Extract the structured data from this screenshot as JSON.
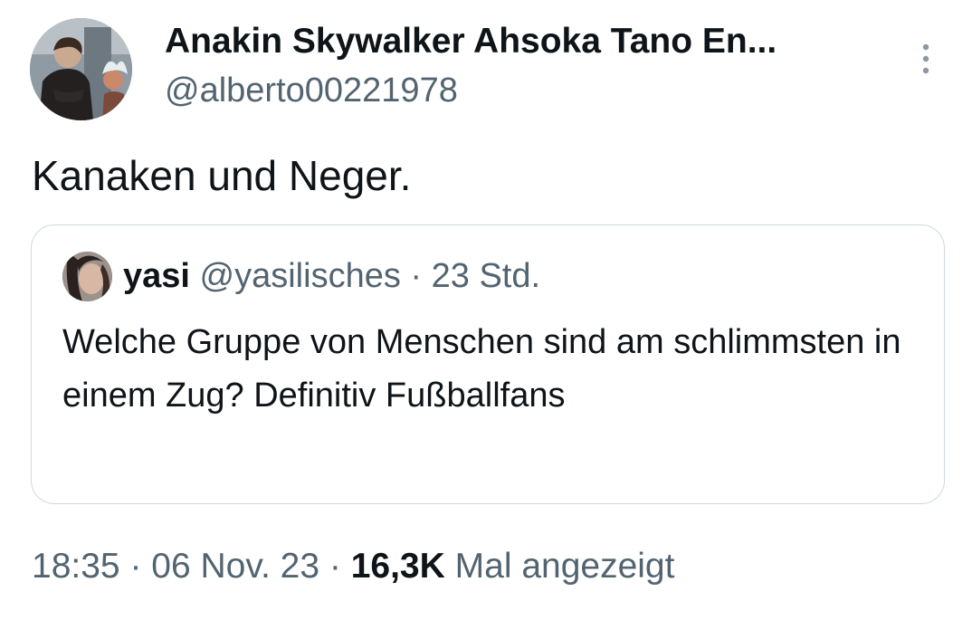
{
  "author": {
    "display_name": "Anakin Skywalker Ahsoka Tano En...",
    "handle": "@alberto00221978",
    "avatar_icon": "profile-photo-avatar"
  },
  "more_icon": "more-vertical-icon",
  "tweet": {
    "text": "Kanaken und Neger."
  },
  "quote": {
    "avatar_icon": "profile-photo-avatar",
    "name": "yasi",
    "handle": "@yasilisches",
    "separator": "·",
    "time": "23 Std.",
    "text": "Welche Gruppe von Menschen sind am schlimmsten in einem Zug? Definitiv Fußballfans"
  },
  "meta": {
    "time": "18:35",
    "separator": "·",
    "date": "06 Nov. 23",
    "views_count": "16,3K",
    "views_label": "Mal angezeigt"
  },
  "colors": {
    "primary_text": "#0f1419",
    "secondary_text": "#536471",
    "border": "#cfd9de",
    "background": "#ffffff"
  }
}
